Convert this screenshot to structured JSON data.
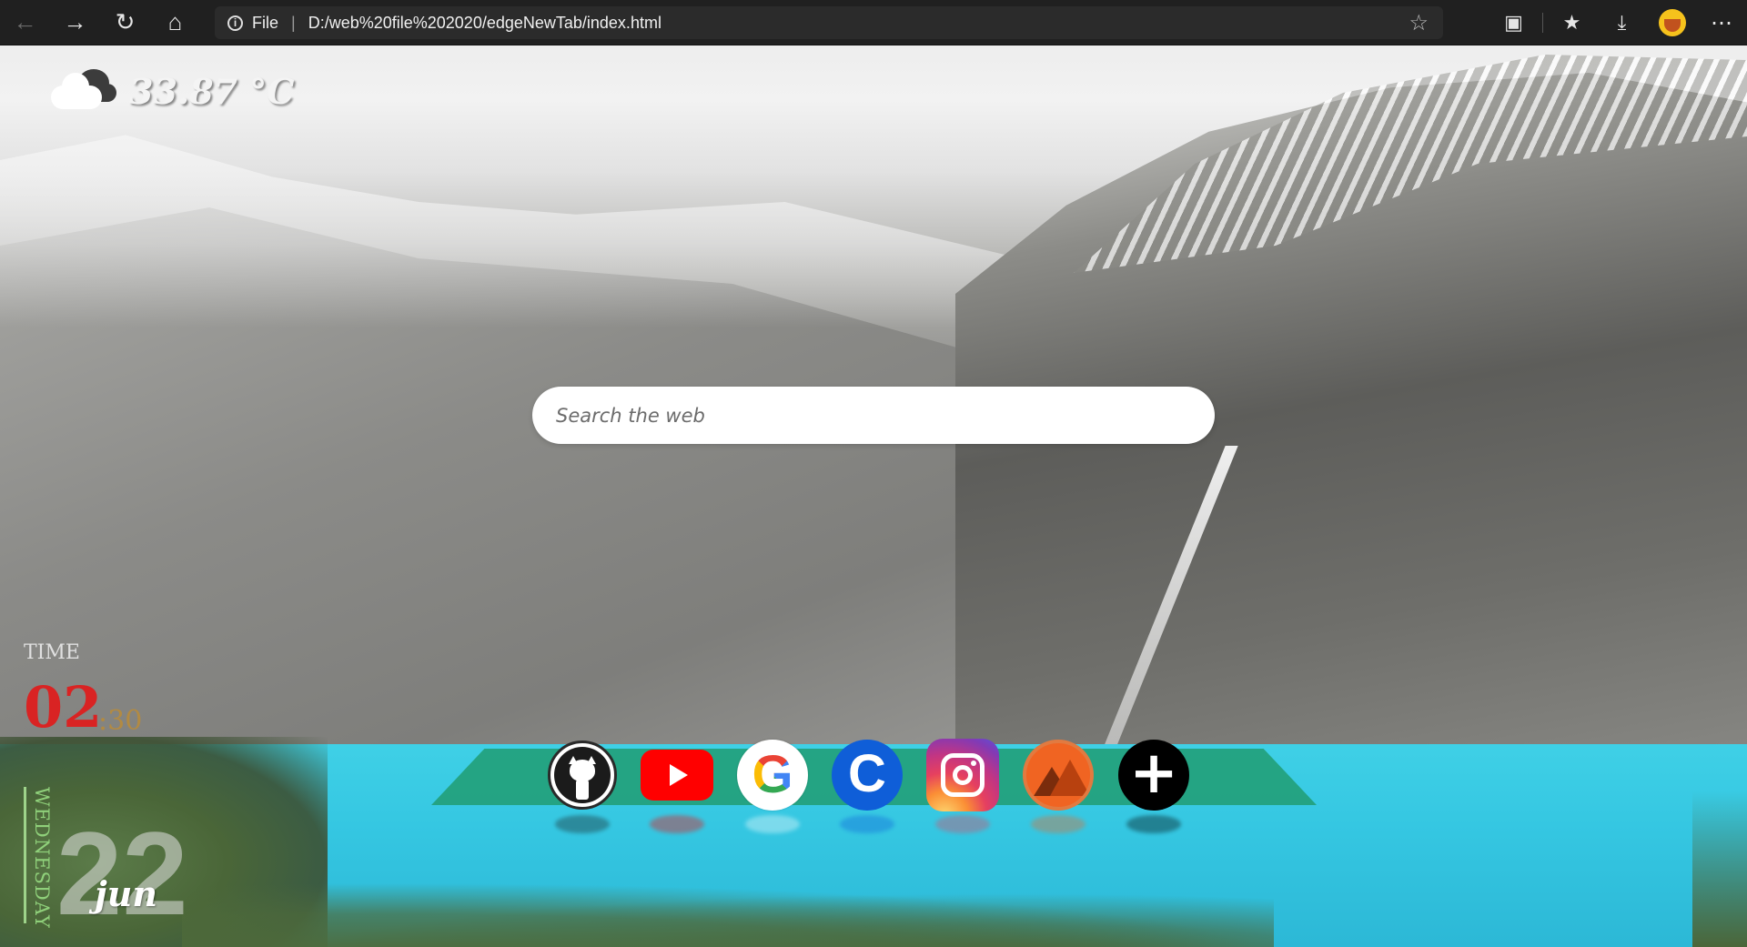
{
  "browser": {
    "scheme_label": "File",
    "url": "D:/web%20file%202020/edgeNewTab/index.html",
    "icons": {
      "back": "arrow-left-icon",
      "forward": "arrow-right-icon",
      "refresh": "refresh-icon",
      "home": "home-icon",
      "site_info": "info-icon",
      "add_favorite": "star-plus-icon",
      "collections": "screen-search-icon",
      "favorites": "star-list-icon",
      "downloads": "download-icon",
      "profile": "profile-avatar",
      "more": "more-icon"
    }
  },
  "weather": {
    "icon": "cloud-icon",
    "temperature": "33.87 °C"
  },
  "search": {
    "placeholder": "Search the web"
  },
  "dock": {
    "shelf_color": "#22a07c",
    "items": [
      {
        "name": "github",
        "icon": "github-icon"
      },
      {
        "name": "youtube",
        "icon": "youtube-icon"
      },
      {
        "name": "google",
        "icon": "google-icon"
      },
      {
        "name": "codechef",
        "icon": "codechef-icon"
      },
      {
        "name": "instagram",
        "icon": "instagram-icon"
      },
      {
        "name": "summit",
        "icon": "mountain-icon"
      },
      {
        "name": "add",
        "icon": "plus-icon"
      }
    ]
  },
  "clock": {
    "label": "TIME",
    "hours": "02",
    "minutes": ":30",
    "day_name": "WEDNESDAY",
    "day_number": "22",
    "month": "jun"
  },
  "colors": {
    "hour_color": "#d92323",
    "day_color": "#8fd07a",
    "lake_color": "#35c7e2"
  }
}
